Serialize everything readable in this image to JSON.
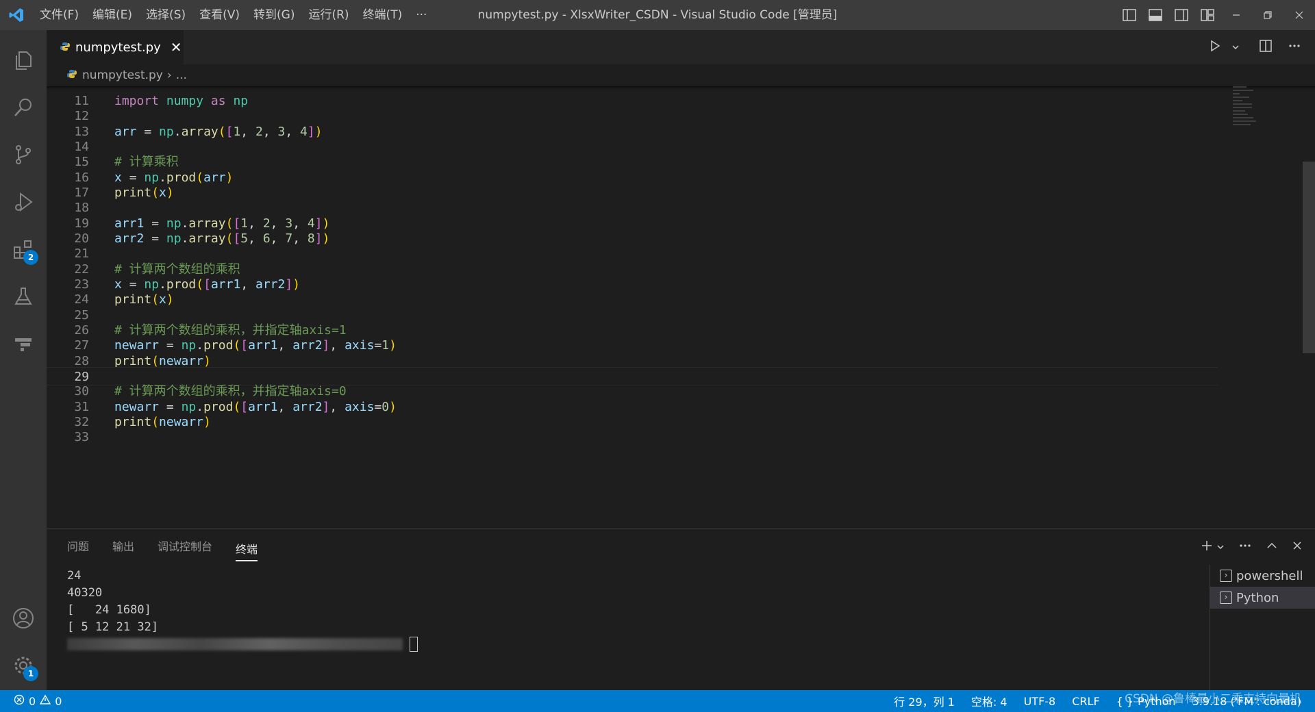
{
  "titlebar": {
    "menus": [
      "文件(F)",
      "编辑(E)",
      "选择(S)",
      "查看(V)",
      "转到(G)",
      "运行(R)",
      "终端(T)",
      "···"
    ],
    "title": "numpytest.py - XlsxWriter_CSDN - Visual Studio Code [管理员]"
  },
  "activity": {
    "extensions_badge": "2",
    "settings_badge": "1"
  },
  "tab": {
    "label": "numpytest.py",
    "close": "✕"
  },
  "breadcrumb": {
    "file": "numpytest.py",
    "sep": "›",
    "rest": "..."
  },
  "editor": {
    "lines": [
      {
        "n": "11"
      },
      {
        "n": "12"
      },
      {
        "n": "13"
      },
      {
        "n": "14"
      },
      {
        "n": "15"
      },
      {
        "n": "16"
      },
      {
        "n": "17"
      },
      {
        "n": "18"
      },
      {
        "n": "19"
      },
      {
        "n": "20"
      },
      {
        "n": "21"
      },
      {
        "n": "22"
      },
      {
        "n": "23"
      },
      {
        "n": "24"
      },
      {
        "n": "25"
      },
      {
        "n": "26"
      },
      {
        "n": "27"
      },
      {
        "n": "28"
      },
      {
        "n": "29"
      },
      {
        "n": "30"
      },
      {
        "n": "31"
      },
      {
        "n": "32"
      },
      {
        "n": "33"
      }
    ],
    "code": {
      "l11": [
        "import",
        "numpy",
        "as",
        "np"
      ],
      "l13": "arr = np.array([1, 2, 3, 4])",
      "l15": "# 计算乘积",
      "l16": "x = np.prod(arr)",
      "l17": "print(x)",
      "l19": "arr1 = np.array([1, 2, 3, 4])",
      "l20": "arr2 = np.array([5, 6, 7, 8])",
      "l22": "# 计算两个数组的乘积",
      "l23": "x = np.prod([arr1, arr2])",
      "l24": "print(x)",
      "l26": "# 计算两个数组的乘积，并指定轴axis=1",
      "l27": "newarr = np.prod([arr1, arr2], axis=1)",
      "l28": "print(newarr)",
      "l30": "# 计算两个数组的乘积，并指定轴axis=0",
      "l31": "newarr = np.prod([arr1, arr2], axis=0)",
      "l32": "print(newarr)"
    },
    "current_line": "29"
  },
  "panel": {
    "tabs": [
      "问题",
      "输出",
      "调试控制台",
      "终端"
    ],
    "active_tab": "终端",
    "terminal_output": [
      "24",
      "40320",
      "[   24 1680]",
      "[ 5 12 21 32]"
    ],
    "terminals": [
      "powershell",
      "Python"
    ],
    "selected_terminal": "Python"
  },
  "statusbar": {
    "errors": "0",
    "warnings": "0",
    "position": "行 29，列 1",
    "spaces": "空格: 4",
    "encoding": "UTF-8",
    "eol": "CRLF",
    "language": "Python",
    "interpreter": "3.9.18 ('FM': conda)"
  },
  "watermark": "CSDN @鲁棒最小二乘支持向量机",
  "colors": {
    "accent": "#007acc",
    "titlebar": "#3c3c3c",
    "activitybar": "#333333",
    "editor_bg": "#1e1e1e"
  }
}
